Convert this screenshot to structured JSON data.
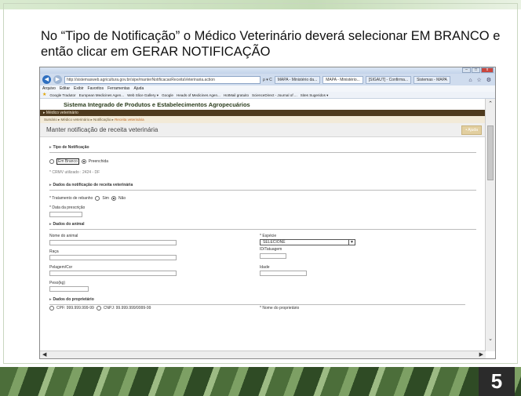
{
  "slide": {
    "caption": "No “Tipo de Notificação” o Médico Veterinário deverá selecionar EM BRANCO e então clicar em GERAR NOTIFICAÇÃO",
    "page_number": "5"
  },
  "browser": {
    "url": "http://sistemasweb.agricultura.gov.br/sipe/manterNotificacaoReceitaVeterinaria.action",
    "url_tools": "ρ ▾ C",
    "tabs": [
      "MAPA - Ministério da...",
      "MAPA - Ministério...",
      "[SIGAUT] - Confirma...",
      "Sistemas - MAPA"
    ],
    "active_tab_index": 1,
    "toolbar_icons": "⌂ ☆ ⚙",
    "window_buttons": [
      "–",
      "□",
      "x"
    ],
    "menu": [
      "Arquivo",
      "Editar",
      "Exibir",
      "Favoritos",
      "Ferramentas",
      "Ajuda"
    ],
    "favorites": [
      "Google Tradutor",
      "European Medicines Agen...",
      "Web Slice Gallery ▾",
      "Google",
      "Heads of Medicines Agen...",
      "HotMail gratuito",
      "ScienceDirect - Journal of ...",
      "Sites Sugeridos ▾"
    ]
  },
  "app": {
    "system_title": "Sistema Integrado de Produtos e Estabelecimentos Agropecuários",
    "profile": "▸ Médico veterinário",
    "breadcrumb": "Sumário ▸ Médico veterinário ▸ Notificação ▸ ",
    "breadcrumb_current": "Receita veterinária",
    "page_title": "Manter notificação de receita veterinária",
    "help_label": "• Ajuda",
    "sections": {
      "tipo": "Tipo de Notificação",
      "dados_notificacao": "Dados da notificação de receita veterinária",
      "dados_animal": "Dados do animal",
      "dados_proprietario": "Dados do proprietário"
    },
    "tipo_options": [
      "Em Branco",
      "Preenchida"
    ],
    "tipo_selected": "Preenchida",
    "crmv": "* CRMV utilizado : 2424 - DF",
    "tratamento_label": "* Tratamento de rebanho",
    "tratamento_options": [
      "Sim",
      "Não"
    ],
    "tratamento_selected": "Não",
    "data_prescricao_label": "* Data da prescrição",
    "animal": {
      "nome_label": "Nome do animal",
      "especie_label": "* Espécie",
      "especie_value": "SELECIONE",
      "raca_label": "Raça",
      "id_tatuagem_label": "ID/Tatuagem",
      "pelagem_label": "Pelagem/Cor",
      "idade_label": "Idade",
      "peso_label": "Peso(kg)"
    },
    "proprietario": {
      "doc_options": [
        "CPF: 999.999.999-99",
        "CNPJ: 99.999.999/9999-99"
      ],
      "nome_label": "* Nome do proprietário"
    }
  }
}
